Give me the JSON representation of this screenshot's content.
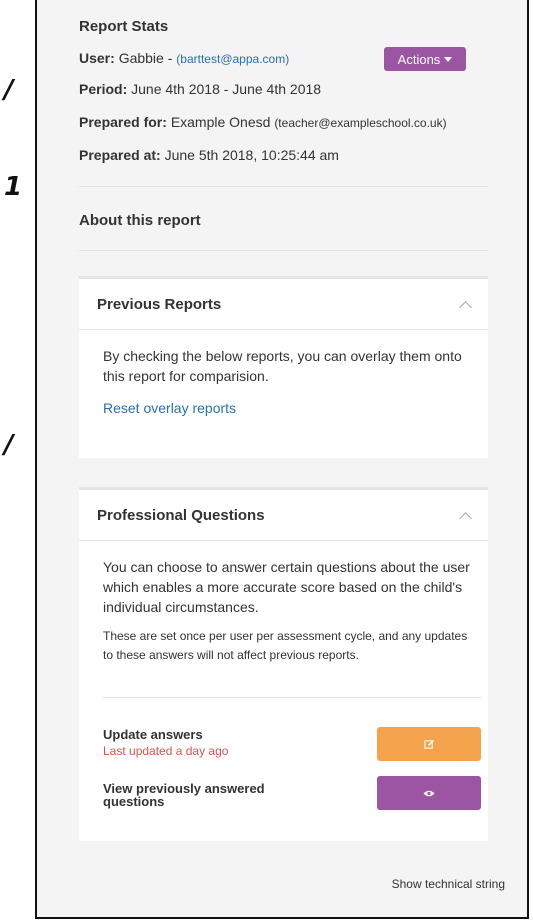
{
  "report_stats": {
    "title": "Report Stats",
    "user_label": "User:",
    "user_name": "Gabbie",
    "user_separator": " - ",
    "user_email": "(barttest@appa.com)",
    "actions_label": "Actions",
    "period_label": "Period:",
    "period_value": "June 4th 2018 - June 4th 2018",
    "prepared_for_label": "Prepared for:",
    "prepared_for_name": "Example Onesd",
    "prepared_for_email": "(teacher@exampleschool.co.uk)",
    "prepared_at_label": "Prepared at:",
    "prepared_at_value": "June 5th 2018, 10:25:44 am"
  },
  "about": {
    "title": "About this report"
  },
  "previous_reports": {
    "title": "Previous Reports",
    "description": "By checking the below reports, you can overlay them onto this report for comparision.",
    "reset_link": "Reset overlay reports"
  },
  "professional_questions": {
    "title": "Professional Questions",
    "description": "You can choose to answer certain questions about the user which enables a more accurate score based on the child's individual circumstances.",
    "note": "These are set once per user per assessment cycle, and any updates to these answers will not affect previous reports.",
    "update_label": "Update answers",
    "update_status": "Last updated a day ago",
    "view_label": "View previously answered questions"
  },
  "footer": {
    "technical_link": "Show technical string"
  },
  "colors": {
    "accent_purple": "#9c55a3",
    "accent_orange": "#f5a24c",
    "link": "#2a6fb3",
    "warning": "#d9534f"
  }
}
